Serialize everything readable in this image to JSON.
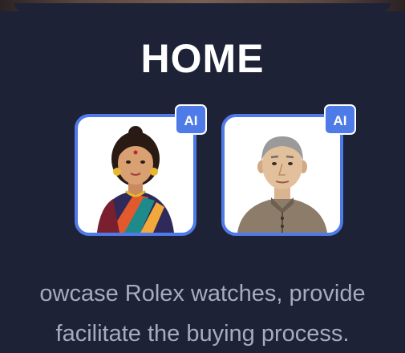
{
  "page": {
    "title": "HOME"
  },
  "avatars": [
    {
      "name": "avatar-woman-saree",
      "badge": "AI"
    },
    {
      "name": "avatar-elderly-man",
      "badge": "AI"
    }
  ],
  "description": {
    "line1": "owcase Rolex watches, provide",
    "line2": "facilitate the buying process."
  },
  "colors": {
    "background": "#1e2236",
    "accent": "#4f7be8",
    "title": "#ffffff",
    "description": "#a7abbe"
  }
}
